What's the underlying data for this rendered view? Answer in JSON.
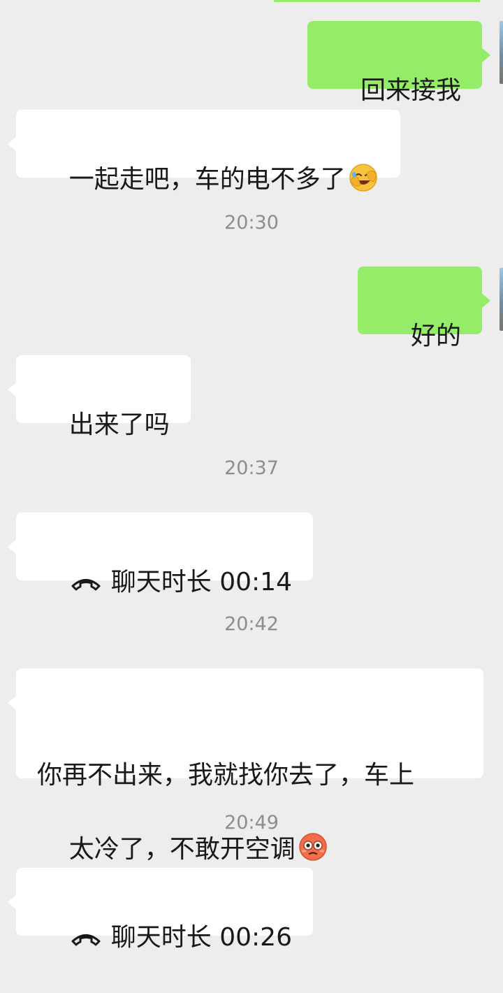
{
  "messages": {
    "m1": "回来接我",
    "m2": "一起走吧，车的电不多了",
    "m3": "好的",
    "m4": "出来了吗",
    "m5": "聊天时长 00:14",
    "m6_line1": "你再不出来，我就找你去了，车上",
    "m6_line2": "太冷了，不敢开空调",
    "m7": "聊天时长 00:26"
  },
  "timestamps": {
    "t1": "20:30",
    "t2": "20:37",
    "t3": "20:42",
    "t4": "20:49"
  },
  "icons": {
    "laugh_emoji": "face-palm-laughing-emoji",
    "flushed_emoji": "flushed-face-emoji",
    "call": "phone-hangup-icon"
  },
  "colors": {
    "background": "#ededed",
    "outgoing_bubble": "#95ec69",
    "incoming_bubble": "#ffffff",
    "timestamp_text": "#8d8d8d"
  }
}
